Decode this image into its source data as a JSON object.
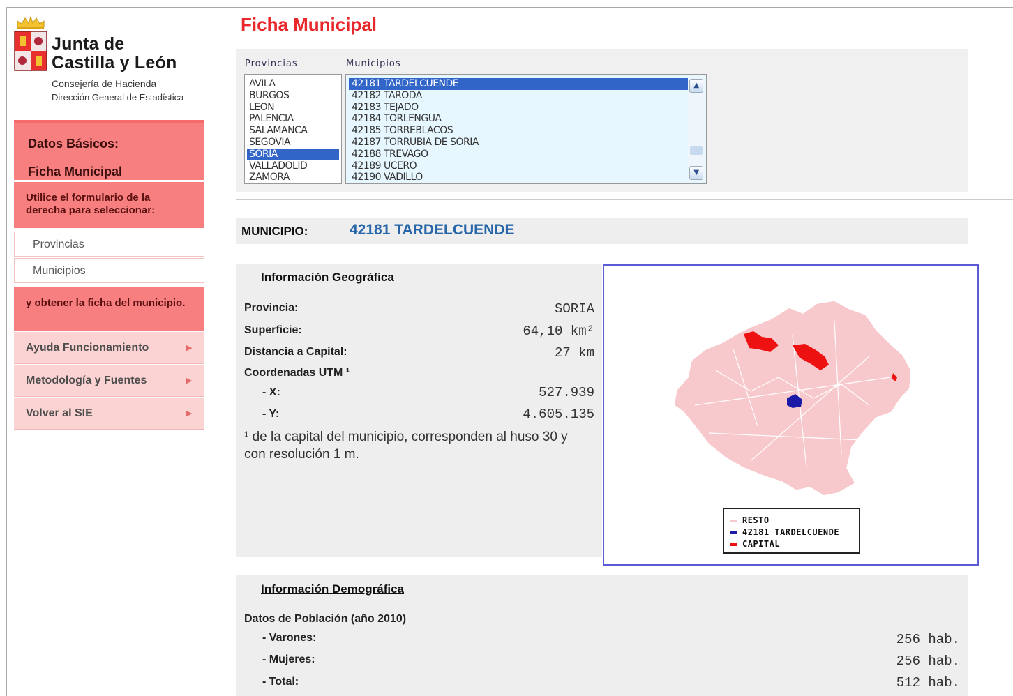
{
  "header": {
    "org_line1": "Junta de",
    "org_line2": "Castilla y León",
    "org_sub1": "Consejería de Hacienda",
    "org_sub2": "Dirección General de Estadística",
    "page_title": "Ficha Municipal"
  },
  "sidebar": {
    "basic_title": "Datos Básicos:",
    "basic_current": "Ficha Municipal",
    "help_text_1": "Utilice el formulario de la derecha para seleccionar:",
    "link_provincias": "Provincias",
    "link_municipios": "Municipios",
    "help_text_2": "y obtener la ficha del municipio.",
    "menu": [
      {
        "label": "Ayuda Funcionamiento"
      },
      {
        "label": "Metodología y Fuentes"
      },
      {
        "label": "Volver al SIE"
      }
    ]
  },
  "selector": {
    "provincias_label": "Provincias",
    "municipios_label": "Municipios",
    "provincias": [
      "AVILA",
      "BURGOS",
      "LEON",
      "PALENCIA",
      "SALAMANCA",
      "SEGOVIA",
      "SORIA",
      "VALLADOLID",
      "ZAMORA"
    ],
    "selected_provincia": "SORIA",
    "municipios": [
      "42181 TARDELCUENDE",
      "42182 TARODA",
      "42183 TEJADO",
      "42184 TORLENGUA",
      "42185 TORREBLACOS",
      "42187 TORRUBIA DE SORIA",
      "42188 TREVAGO",
      "42189 UCERO",
      "42190 VADILLO"
    ],
    "selected_municipio": "42181 TARDELCUENDE"
  },
  "municipio": {
    "label": "MUNICIPIO:",
    "value": "42181 TARDELCUENDE"
  },
  "geo": {
    "title": "Información Geográfica",
    "provincia_label": "Provincia:",
    "provincia_value": "SORIA",
    "superficie_label": "Superficie:",
    "superficie_value": "64,10 km²",
    "distancia_label": "Distancia a Capital:",
    "distancia_value": "27 km",
    "coord_label": "Coordenadas UTM ¹",
    "x_label": "- X:",
    "x_value": "527.939",
    "y_label": "- Y:",
    "y_value": "4.605.135",
    "note": "¹ de la capital del municipio, corresponden al huso 30 y con resolución 1 m."
  },
  "map": {
    "legend": [
      {
        "label": "RESTO",
        "color": "#f8c9cc"
      },
      {
        "label": "42181 TARDELCUENDE",
        "color": "#1a1aa6"
      },
      {
        "label": "CAPITAL",
        "color": "#ee1111"
      }
    ]
  },
  "demo": {
    "title": "Información Demográfica",
    "population_label": "Datos de Población (año 2010)",
    "varones_label": "- Varones:",
    "varones_value": "256 hab.",
    "mujeres_label": "- Mujeres:",
    "mujeres_value": "256 hab.",
    "total_label": "- Total:",
    "total_value": "512 hab."
  }
}
